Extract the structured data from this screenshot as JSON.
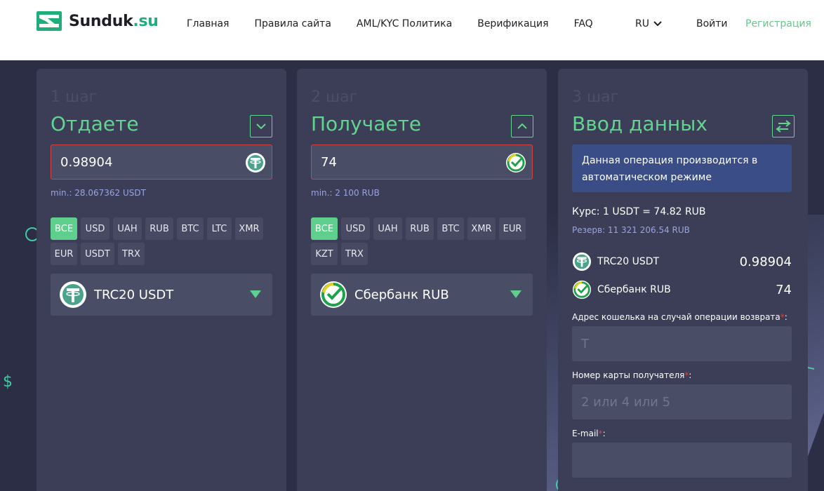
{
  "header": {
    "logo_text": "Sunduk",
    "logo_domain": ".su",
    "nav": [
      "Главная",
      "Правила сайта",
      "AML/KYC Политика",
      "Верификация",
      "FAQ"
    ],
    "lang": "RU",
    "login": "Войти",
    "register": "Регистрация"
  },
  "give": {
    "step": "1 шаг",
    "title": "Отдаете",
    "amount": "0.98904",
    "min": "min.: 28.067362 USDT",
    "chips": [
      "ВСЕ",
      "USD",
      "UAH",
      "RUB",
      "BTC",
      "LTC",
      "XMR",
      "EUR",
      "USDT",
      "TRX"
    ],
    "selected": "TRC20 USDT"
  },
  "receive": {
    "step": "2 шаг",
    "title": "Получаете",
    "amount": "74",
    "min": "min.: 2 100 RUB",
    "chips": [
      "ВСЕ",
      "USD",
      "UAH",
      "RUB",
      "BTC",
      "XMR",
      "EUR",
      "KZT",
      "TRX"
    ],
    "selected": "Сбербанк RUB"
  },
  "details": {
    "step": "3 шаг",
    "title": "Ввод данных",
    "notice": "Данная операция производится в автоматическом режиме",
    "rate": "Курс: 1 USDT = 74.82 RUB",
    "reserve": "Резерв: 11 321 206.54 RUB",
    "give_name": "TRC20 USDT",
    "give_value": "0.98904",
    "receive_name": "Сбербанк RUB",
    "receive_value": "74",
    "wallet_label": "Адрес кошелька на случай операции возврата",
    "wallet_placeholder": "T",
    "card_label": "Номер карты получателя",
    "card_placeholder": "2 или 4 или 5",
    "email_label": "E-mail",
    "req": "*",
    "colon": ":"
  },
  "colors": {
    "accent": "#63d48f",
    "error": "#d6423f",
    "card_bg": "#3b3e56",
    "notice_bg": "#3a4d86"
  }
}
